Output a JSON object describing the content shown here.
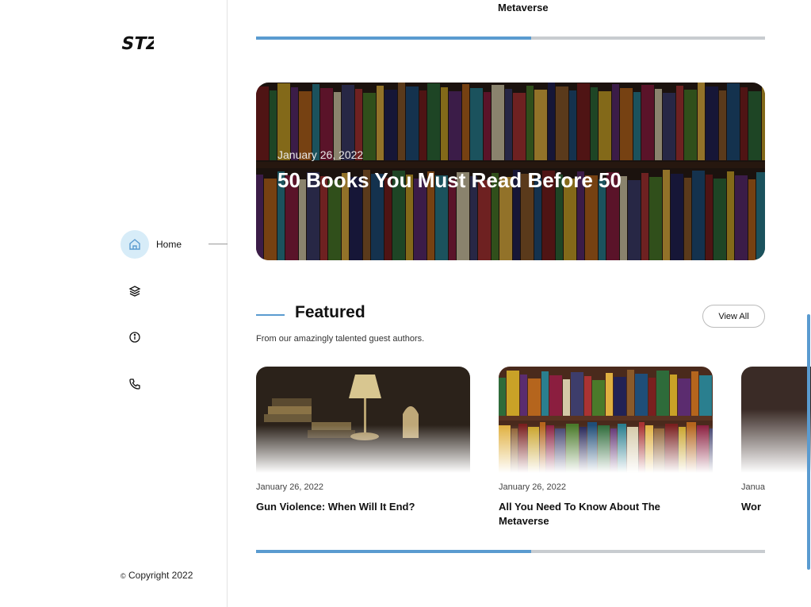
{
  "sidebar": {
    "logo_text": "STZ",
    "items": [
      {
        "label": "Home",
        "icon": "home-icon",
        "active": true
      },
      {
        "label": "",
        "icon": "layers-icon",
        "active": false
      },
      {
        "label": "",
        "icon": "info-icon",
        "active": false
      },
      {
        "label": "",
        "icon": "phone-icon",
        "active": false
      }
    ],
    "copyright_symbol": "©",
    "copyright_text": "Copyright 2022"
  },
  "top_carousel": {
    "partial_title": "Metaverse",
    "progress": 0.54
  },
  "hero": {
    "date": "January 26, 2022",
    "title": "50 Books You Must Read Before 50"
  },
  "featured": {
    "title": "Featured",
    "subtitle": "From our amazingly talented guest authors.",
    "view_all_label": "View All",
    "progress": 0.54,
    "cards": [
      {
        "date": "January 26, 2022",
        "title": "Gun Violence: When Will It End?"
      },
      {
        "date": "January 26, 2022",
        "title": "All You Need To Know About The Metaverse"
      },
      {
        "date": "Janua",
        "title": "Wor"
      }
    ]
  },
  "colors": {
    "accent": "#5a9bd0",
    "active_nav_bg": "#d7ecf8",
    "progress_track": "#c8ccd0"
  }
}
